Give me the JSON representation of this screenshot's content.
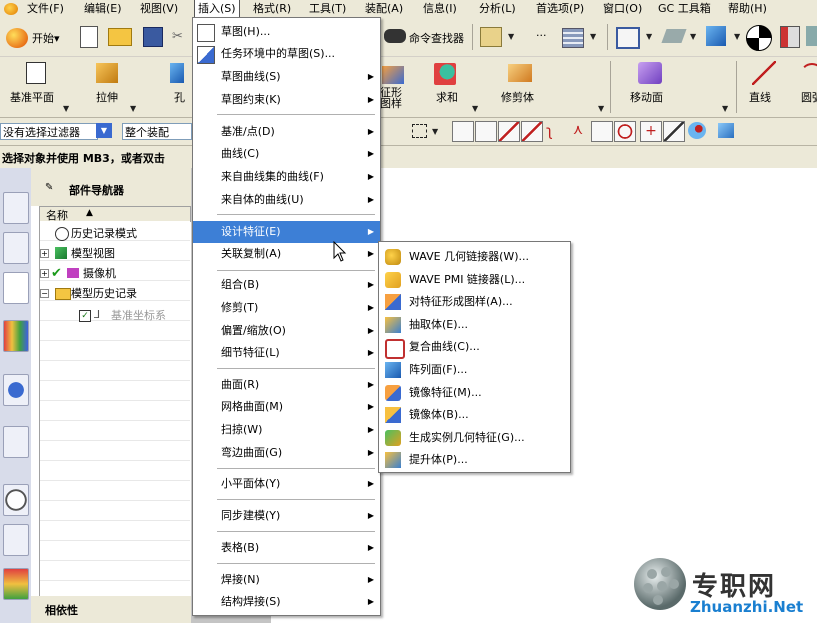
{
  "menubar": {
    "items": [
      {
        "label": "文件(F)",
        "name": "file"
      },
      {
        "label": "编辑(E)",
        "name": "edit"
      },
      {
        "label": "视图(V)",
        "name": "view"
      },
      {
        "label": "插入(S)",
        "name": "insert"
      },
      {
        "label": "格式(R)",
        "name": "format"
      },
      {
        "label": "工具(T)",
        "name": "tools"
      },
      {
        "label": "装配(A)",
        "name": "assembly"
      },
      {
        "label": "信息(I)",
        "name": "information"
      },
      {
        "label": "分析(L)",
        "name": "analysis"
      },
      {
        "label": "首选项(P)",
        "name": "preferences"
      },
      {
        "label": "窗口(O)",
        "name": "window"
      },
      {
        "label": "GC 工具箱",
        "name": "gc-toolbox"
      },
      {
        "label": "帮助(H)",
        "name": "help"
      }
    ]
  },
  "toolbar1": {
    "start_label": "开始▾",
    "command_finder_label": "命令查找器",
    "more": "..."
  },
  "toolbar2": {
    "datum_plane": "基准平面",
    "extrude": "拉伸",
    "hole": "孔",
    "feature_pattern_partial": "征形\n图样",
    "unite": "求和",
    "trim_body": "修剪体",
    "move_face": "移动面",
    "line": "直线",
    "circle_partial": "圆弧"
  },
  "toolbar3": {
    "filter_value": "没有选择过滤器",
    "scope_value": "整个装配"
  },
  "status": {
    "prompt": "选择对象并使用 MB3，或者双击"
  },
  "navigator": {
    "title": "部件导航器",
    "column_name": "名称",
    "rows": [
      {
        "label": "历史记录模式"
      },
      {
        "label": "模型视图"
      },
      {
        "label": "摄像机"
      },
      {
        "label": "模型历史记录"
      },
      {
        "label": "基准坐标系"
      }
    ],
    "dependency_label": "相依性"
  },
  "insert_menu": {
    "items": [
      {
        "label": "草图(H)...",
        "arrow": ""
      },
      {
        "label": "任务环境中的草图(S)...",
        "arrow": ""
      },
      {
        "label": "草图曲线(S)",
        "arrow": "▶"
      },
      {
        "label": "草图约束(K)",
        "arrow": "▶"
      },
      {
        "label": "基准/点(D)",
        "arrow": "▶"
      },
      {
        "label": "曲线(C)",
        "arrow": "▶"
      },
      {
        "label": "来自曲线集的曲线(F)",
        "arrow": "▶"
      },
      {
        "label": "来自体的曲线(U)",
        "arrow": "▶"
      },
      {
        "label": "设计特征(E)",
        "arrow": "▶"
      },
      {
        "label": "关联复制(A)",
        "arrow": "▶"
      },
      {
        "label": "组合(B)",
        "arrow": "▶"
      },
      {
        "label": "修剪(T)",
        "arrow": "▶"
      },
      {
        "label": "偏置/缩放(O)",
        "arrow": "▶"
      },
      {
        "label": "细节特征(L)",
        "arrow": "▶"
      },
      {
        "label": "曲面(R)",
        "arrow": "▶"
      },
      {
        "label": "网格曲面(M)",
        "arrow": "▶"
      },
      {
        "label": "扫掠(W)",
        "arrow": "▶"
      },
      {
        "label": "弯边曲面(G)",
        "arrow": "▶"
      },
      {
        "label": "小平面体(Y)",
        "arrow": "▶"
      },
      {
        "label": "同步建模(Y)",
        "arrow": "▶"
      },
      {
        "label": "表格(B)",
        "arrow": "▶"
      },
      {
        "label": "焊接(N)",
        "arrow": "▶"
      },
      {
        "label": "结构焊接(S)",
        "arrow": "▶"
      }
    ]
  },
  "associative_copy_submenu": {
    "items": [
      {
        "label": "WAVE 几何链接器(W)..."
      },
      {
        "label": "WAVE PMI 链接器(L)..."
      },
      {
        "label": "对特征形成图样(A)..."
      },
      {
        "label": "抽取体(E)..."
      },
      {
        "label": "复合曲线(C)..."
      },
      {
        "label": "阵列面(F)..."
      },
      {
        "label": "镜像特征(M)..."
      },
      {
        "label": "镜像体(B)..."
      },
      {
        "label": "生成实例几何特征(G)..."
      },
      {
        "label": "提升体(P)..."
      }
    ]
  },
  "watermark": {
    "cn": "专职网",
    "en": "Zhuanzhi.Net"
  },
  "colors": {
    "highlight": "#3d7fd6",
    "toolbar_bg": "#ece9d8",
    "watermark_blue": "#1a7fd0"
  }
}
